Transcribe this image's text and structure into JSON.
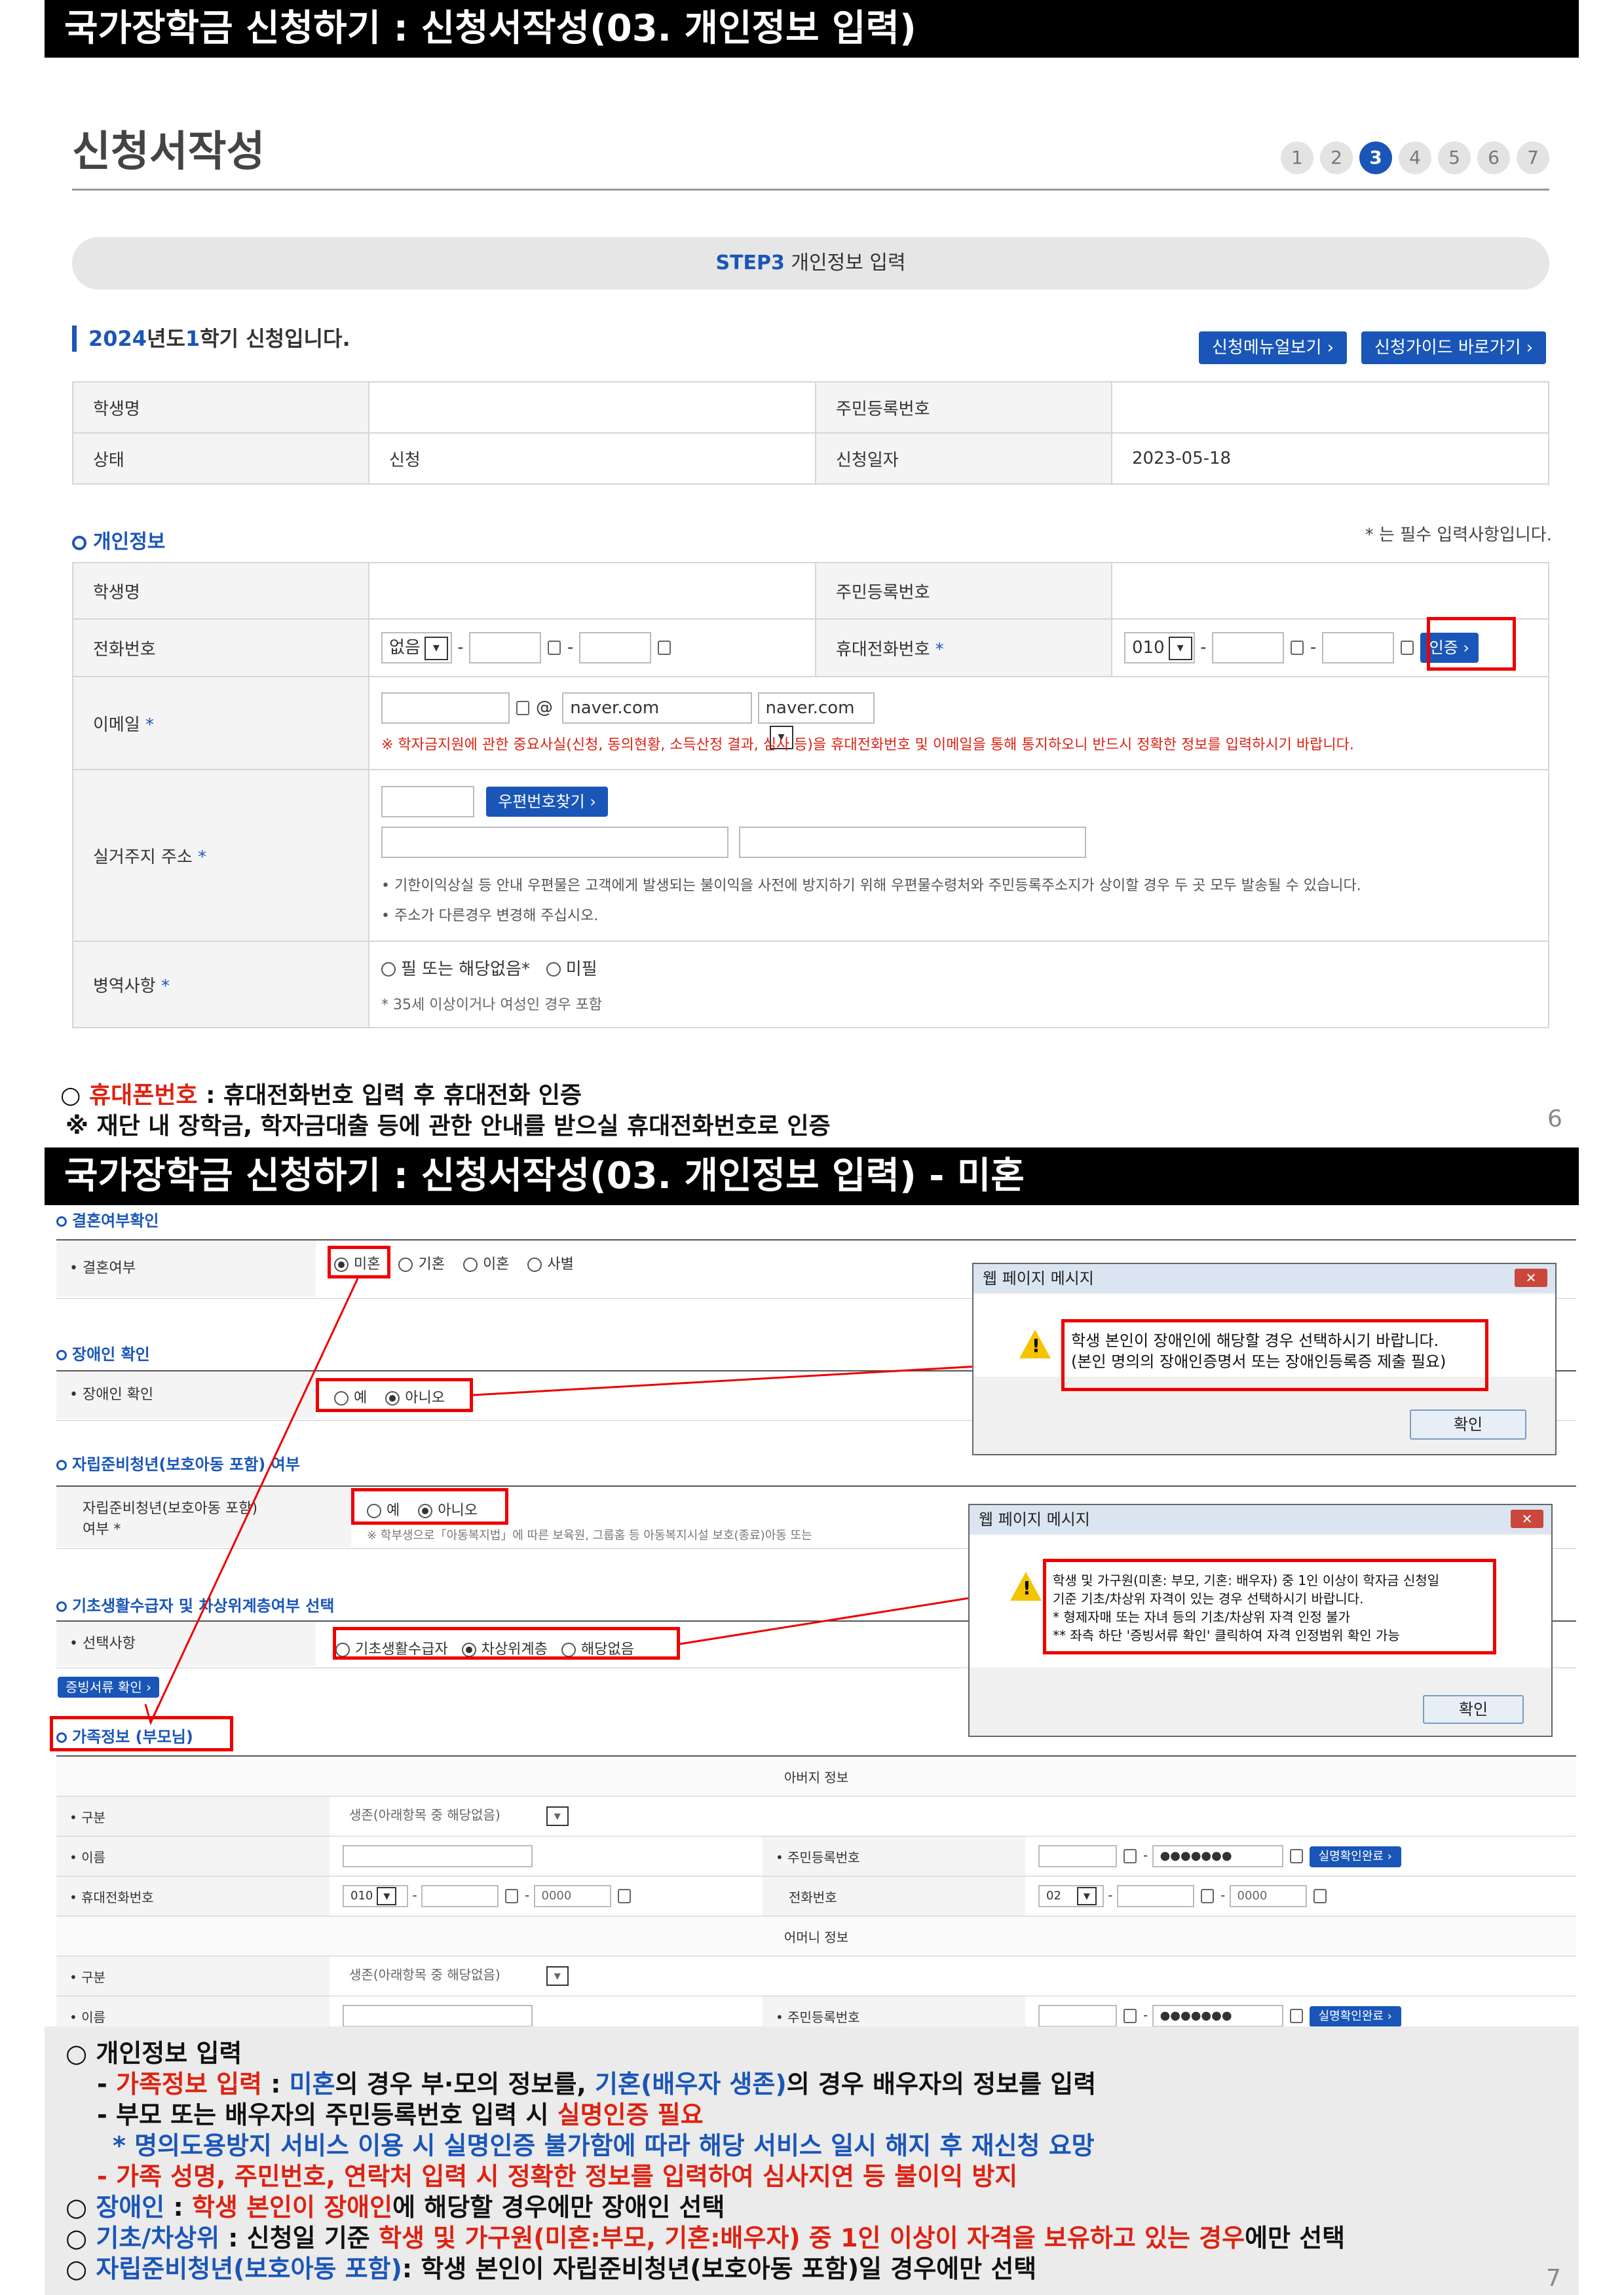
{
  "slide1": {
    "title": "국가장학금 신청하기 : 신청서작성(03. 개인정보 입력)",
    "heading": "신청서작성",
    "steps": [
      "1",
      "2",
      "3",
      "4",
      "5",
      "6",
      "7"
    ],
    "step_bar_step": "STEP3",
    "step_bar_label": "개인정보 입력",
    "semester_year": "2024",
    "semester_mid": "년도",
    "semester_num": "1",
    "semester_rest": "학기 신청입니다.",
    "btn_manual": "신청메뉴얼보기 ›",
    "btn_guide": "신청가이드 바로가기 ›",
    "info_table": {
      "r1": [
        "학생명",
        "",
        "주민등록번호",
        ""
      ],
      "r2": [
        "상태",
        "신청",
        "신청일자",
        "2023-05-18"
      ]
    },
    "personal_head": "개인정보",
    "required_note": "* 는 필수 입력사항입니다.",
    "form": {
      "name_lbl": "학생명",
      "rrn_lbl": "주민등록번호",
      "phone_lbl": "전화번호",
      "phone_sel": "없음",
      "mobile_lbl": "휴대전화번호",
      "mobile_sel": "010",
      "auth_btn": "인증 ›",
      "email_lbl": "이메일",
      "email_at": "@",
      "email_domain": "naver.com",
      "email_domain_sel": "naver.com",
      "email_warn": "※ 학자금지원에 관한 중요사실(신청, 동의현황, 소득산정 결과, 심사 등)을 휴대전화번호 및 이메일을 통해 통지하오니 반드시 정확한 정보를 입력하시기 바랍니다.",
      "addr_lbl": "실거주지 주소",
      "zip_btn": "우편번호찾기 ›",
      "addr_note1": "• 기한이익상실 등 안내 우편물은 고객에게 발생되는 불이익을 사전에 방지하기 위해 우편물수령처와 주민등록주소지가 상이할 경우 두 곳 모두 발송될 수 있습니다.",
      "addr_note2": "• 주소가 다른경우 변경해 주십시오.",
      "mil_lbl": "병역사항",
      "mil_opt1": "필 또는 해당없음*",
      "mil_opt2": "미필",
      "mil_note": "* 35세 이상이거나 여성인 경우 포함",
      "star": "*"
    },
    "note1_a": "○ ",
    "note1_b": "휴대폰번호",
    "note1_c": " : 휴대전화번호 입력 후 휴대전화 인증",
    "note2": "※ 재단 내 장학금, 학자금대출 등에 관한 안내를 받으실 휴대전화번호로 인증",
    "page": "6"
  },
  "slide2": {
    "title": "국가장학금 신청하기 : 신청서작성(03. 개인정보 입력) - 미혼",
    "sec_marriage": "결혼여부확인",
    "marriage_lbl": "• 결혼여부",
    "marriage_opts": [
      "미혼",
      "기혼",
      "이혼",
      "사별"
    ],
    "sec_disabled": "장애인 확인",
    "disabled_lbl": "• 장애인 확인",
    "disabled_opts": [
      "예",
      "아니오"
    ],
    "sec_indep": "자립준비청년(보호아동 포함) 여부",
    "indep_lbl1": "자립준비청년(보호아동 포함)",
    "indep_lbl2": "여부 *",
    "indep_opts": [
      "예",
      "아니오"
    ],
    "indep_note": "※ 학부생으로「아동복지법」에 따른 보육원, 그룹홈 등 아동복지시설 보호(종료)아동 또는",
    "sec_basic": "기초생활수급자 및 차상위계층여부 선택",
    "basic_lbl": "• 선택사항",
    "basic_opts": [
      "기초생활수급자",
      "차상위계층",
      "해당없음"
    ],
    "proof_btn": "증빙서류 확인 ›",
    "sec_family": "가족정보 (부모님)",
    "father_head": "아버지 정보",
    "mother_head": "어머니 정보",
    "lbl_type": "• 구분",
    "type_sel": "생존(아래항목 중 해당없음)",
    "lbl_name": "• 이름",
    "lbl_rrn": "• 주민등록번호",
    "rrn_mask": "●●●●●●●",
    "verify_btn": "실명확인완료 ›",
    "lbl_mobile": "• 휴대전화번호",
    "mobile_pre": "010",
    "mobile_ph": "0000",
    "lbl_tel": "전화번호",
    "tel_pre": "02",
    "dlg_title": "웹 페이지 메시지",
    "dlg1_l1": "학생 본인이 장애인에 해당할 경우 선택하시기 바랍니다.",
    "dlg1_l2": "(본인 명의의 장애인증명서 또는 장애인등록증 제출 필요)",
    "dlg2_l1": "학생 및 가구원(미혼: 부모, 기혼: 배우자) 중 1인 이상이 학자금 신청일",
    "dlg2_l2": "기준 기초/차상위 자격이 있는 경우 선택하시기 바랍니다.",
    "dlg2_l3": "* 형제자매 또는 자녀 등의 기초/차상위 자격 인정 불가",
    "dlg2_l4": "** 좌측 하단 '증빙서류 확인' 클릭하여 자격 인정범위 확인 가능",
    "dlg_ok": "확인",
    "notes": {
      "n1": "○ 개인정보 입력",
      "n2_a": "- ",
      "n2_b": "가족정보 입력",
      "n2_c": " : ",
      "n2_d": "미혼",
      "n2_e": "의 경우 부·모의 정보를, ",
      "n2_f": "기혼(배우자 생존)",
      "n2_g": "의 경우 배우자의 정보를 입력",
      "n3_a": "- 부모 또는 배우자의 주민등록번호 입력 시 ",
      "n3_b": "실명인증 필요",
      "n4": "* 명의도용방지 서비스 이용 시 실명인증 불가함에 따라 해당 서비스 일시 해지 후 재신청 요망",
      "n5": "- 가족 성명, 주민번호, 연락처 입력 시 정확한 정보를 입력하여 심사지연 등 불이익 방지",
      "n6_a": "○ ",
      "n6_b": "장애인",
      "n6_c": " : ",
      "n6_d": "학생 본인이 장애인",
      "n6_e": "에 해당할 경우에만 장애인 선택",
      "n7_a": "○ ",
      "n7_b": "기초/차상위",
      "n7_c": " : 신청일 기준 ",
      "n7_d": "학생 및 가구원(미혼:부모, 기혼:배우자) 중 1인 이상이 자격을 보유하고 있는 경우",
      "n7_e": "에만 선택",
      "n8_a": "○ ",
      "n8_b": "자립준비청년(보호아동 포함)",
      "n8_c": ": 학생 본인이 자립준비청년(보호아동 포함)일 경우에만 선택"
    },
    "page": "7"
  }
}
